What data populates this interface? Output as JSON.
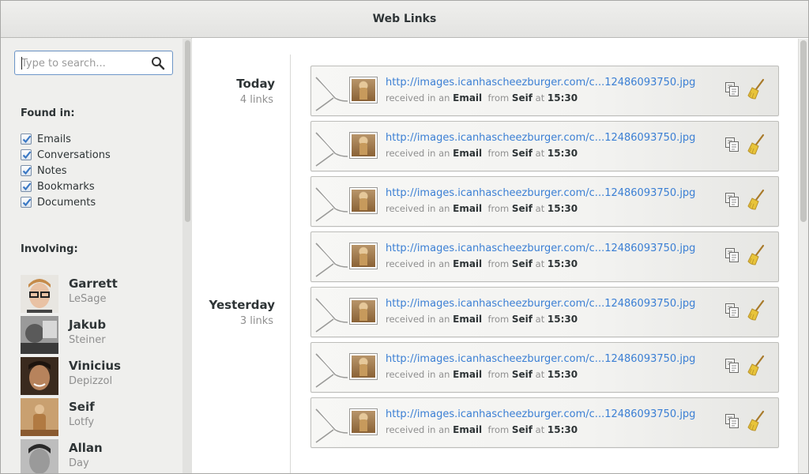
{
  "window": {
    "title": "Web Links"
  },
  "search": {
    "placeholder": "Type to search..."
  },
  "found_in": {
    "title": "Found in:",
    "items": [
      {
        "label": "Emails",
        "checked": true
      },
      {
        "label": "Conversations",
        "checked": true
      },
      {
        "label": "Notes",
        "checked": true
      },
      {
        "label": "Bookmarks",
        "checked": true
      },
      {
        "label": "Documents",
        "checked": true
      }
    ]
  },
  "involving": {
    "title": "Involving:",
    "people": [
      {
        "first": "Garrett",
        "last": "LeSage"
      },
      {
        "first": "Jakub",
        "last": "Steiner"
      },
      {
        "first": "Vinicius",
        "last": "Depizzol"
      },
      {
        "first": "Seif",
        "last": "Lotfy"
      },
      {
        "first": "Allan",
        "last": "Day"
      }
    ]
  },
  "groups": [
    {
      "label": "Today",
      "count": "4 links"
    },
    {
      "label": "Yesterday",
      "count": "3 links"
    }
  ],
  "links": [
    {
      "url": "http://images.icanhascheezburger.com/c...12486093750.jpg",
      "received": "received in an",
      "source": "Email",
      "from": "from",
      "sender": "Seif",
      "at": "at",
      "time": "15:30"
    },
    {
      "url": "http://images.icanhascheezburger.com/c...12486093750.jpg",
      "received": "received in an",
      "source": "Email",
      "from": "from",
      "sender": "Seif",
      "at": "at",
      "time": "15:30"
    },
    {
      "url": "http://images.icanhascheezburger.com/c...12486093750.jpg",
      "received": "received in an",
      "source": "Email",
      "from": "from",
      "sender": "Seif",
      "at": "at",
      "time": "15:30"
    },
    {
      "url": "http://images.icanhascheezburger.com/c...12486093750.jpg",
      "received": "received in an",
      "source": "Email",
      "from": "from",
      "sender": "Seif",
      "at": "at",
      "time": "15:30"
    },
    {
      "url": "http://images.icanhascheezburger.com/c...12486093750.jpg",
      "received": "received in an",
      "source": "Email",
      "from": "from",
      "sender": "Seif",
      "at": "at",
      "time": "15:30"
    },
    {
      "url": "http://images.icanhascheezburger.com/c...12486093750.jpg",
      "received": "received in an",
      "source": "Email",
      "from": "from",
      "sender": "Seif",
      "at": "at",
      "time": "15:30"
    },
    {
      "url": "http://images.icanhascheezburger.com/c...12486093750.jpg",
      "received": "received in an",
      "source": "Email",
      "from": "from",
      "sender": "Seif",
      "at": "at",
      "time": "15:30"
    }
  ],
  "icons": {
    "search": "search-icon",
    "checkbox": "checkmark-icon",
    "envelope": "envelope-icon",
    "copy": "copy-icon",
    "clean": "broom-icon"
  },
  "colors": {
    "link": "#3b7fd4",
    "search_border": "#6e97c9",
    "check": "#3a78c4"
  }
}
